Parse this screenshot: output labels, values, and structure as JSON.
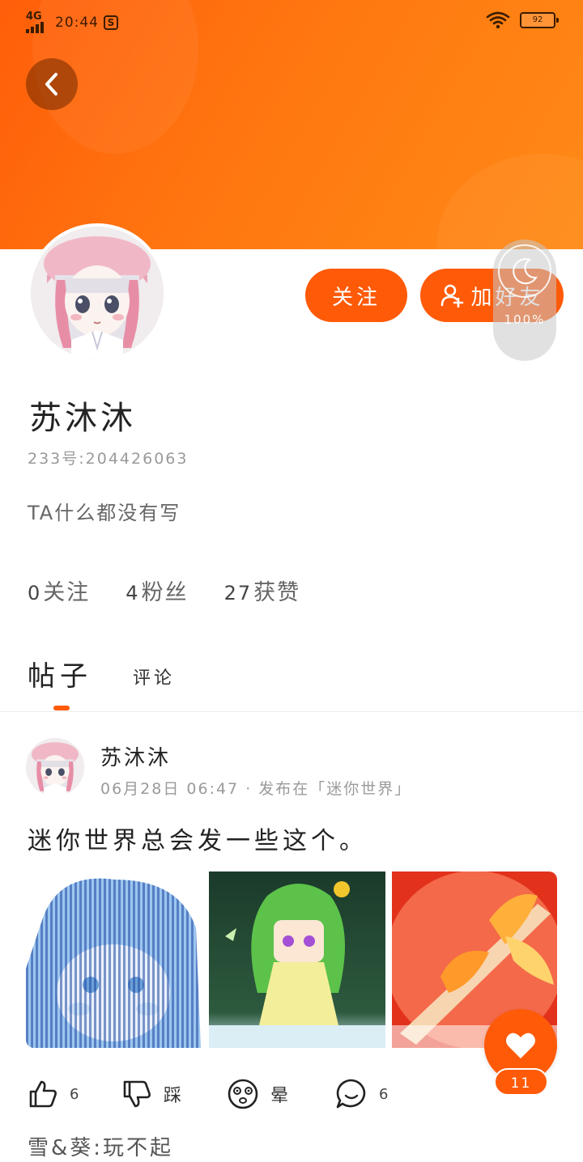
{
  "status_bar": {
    "network": "4G",
    "time": "20:44",
    "app_badge": "S",
    "battery": "92"
  },
  "profile": {
    "username": "苏沐沐",
    "user_id": "233号:204426063",
    "bio": "TA什么都没有写",
    "follow_button": "关注",
    "add_friend_button": "加好友",
    "float_widget_percent": "100%",
    "stats": [
      {
        "value": "0",
        "label": "关注"
      },
      {
        "value": "4",
        "label": "粉丝"
      },
      {
        "value": "27",
        "label": "获赞"
      }
    ]
  },
  "tabs": {
    "posts": "帖子",
    "comments": "评论",
    "active": "posts"
  },
  "post": {
    "author": "苏沐沐",
    "meta": "06月28日  06:47 · 发布在「迷你世界」",
    "text": "迷你世界总会发一些这个。",
    "actions": {
      "like_count": "6",
      "dislike_label": "踩",
      "dizzy_label": "晕",
      "comment_count": "6"
    },
    "favorite_count": "11",
    "comment_preview": "雪&葵:玩不起"
  },
  "colors": {
    "accent": "#ff5a08",
    "header_gradient_start": "#ff5e0a",
    "header_gradient_end": "#ff8a16"
  },
  "icons": [
    "back-arrow-icon",
    "add-user-icon",
    "thumbs-up-icon",
    "thumbs-down-icon",
    "dizzy-face-icon",
    "comment-bubble-icon",
    "heart-icon",
    "wifi-icon",
    "moon-icon"
  ]
}
